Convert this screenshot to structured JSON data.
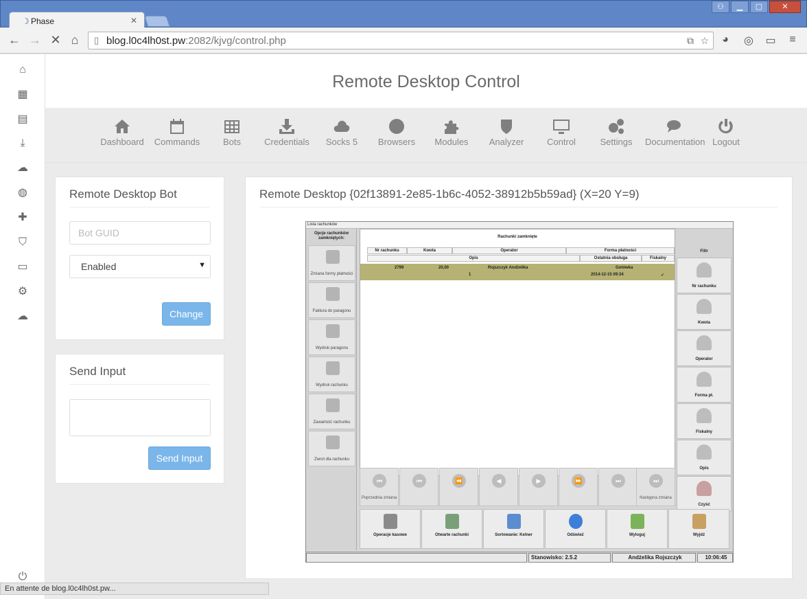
{
  "browser": {
    "tab_title": "Phase",
    "url_host": "blog.l0c4lh0st.pw",
    "url_rest": ":2082/kjvg/control.php",
    "status_text": "En attente de blog.l0c4lh0st.pw..."
  },
  "app": {
    "title": "Remote Desktop Control",
    "nav": [
      {
        "label": "Dashboard",
        "icon": "home-icon"
      },
      {
        "label": "Commands",
        "icon": "calendar-icon"
      },
      {
        "label": "Bots",
        "icon": "table-icon"
      },
      {
        "label": "Credentials",
        "icon": "download-icon"
      },
      {
        "label": "Socks 5",
        "icon": "cloud-icon"
      },
      {
        "label": "Browsers",
        "icon": "globe-icon"
      },
      {
        "label": "Modules",
        "icon": "puzzle-icon"
      },
      {
        "label": "Analyzer",
        "icon": "shield-icon"
      },
      {
        "label": "Control",
        "icon": "monitor-icon"
      },
      {
        "label": "Settings",
        "icon": "gears-icon"
      },
      {
        "label": "Documentation",
        "icon": "comments-icon"
      },
      {
        "label": "Logout",
        "icon": "power-icon"
      }
    ],
    "sidebar_icons": [
      "home-icon",
      "calendar-icon",
      "table-icon",
      "download-icon",
      "cloud-icon",
      "globe-icon",
      "puzzle-icon",
      "shield-icon",
      "monitor-icon",
      "gears-icon",
      "comments-icon",
      "power-icon"
    ]
  },
  "bot_panel": {
    "title": "Remote Desktop Bot",
    "guid_placeholder": "Bot GUID",
    "status_value": "Enabled",
    "button": "Change"
  },
  "input_panel": {
    "title": "Send Input",
    "button": "Send Input"
  },
  "desktop": {
    "title": "Remote Desktop {02f13891-2e85-1b6c-4052-38912b5b59ad} (X=20 Y=9)",
    "window_title": "Lista rachunków",
    "left_header": "Opcje rachunków zamkniętych:",
    "left_buttons": [
      "Zmiana formy płatności",
      "Faktura do paragonu",
      "Wydruk paragonu",
      "Wydruk rachunku",
      "Zawartość rachunku",
      "Zwrot dla rachunku"
    ],
    "main_header": "Rachunki zamknięte",
    "columns_row1": [
      "Nr rachunku",
      "Kwota",
      "Operator",
      "Forma płatności"
    ],
    "columns_row2": [
      "Opis",
      "Ostatnia obsługa",
      "Fiskalny"
    ],
    "row": {
      "nr": "2799",
      "kwota": "20,00",
      "operator": "Rojszczyk Andżelika",
      "forma": "Gotówka",
      "opis": "1",
      "ostatnia": "2014-12-15 09:34",
      "fiskalny": "✓"
    },
    "filter_header": "Filtr",
    "filter_buttons": [
      "Nr rachunku",
      "Kwota",
      "Operator",
      "Forma pł.",
      "Fiskalny",
      "Opis",
      "Czyść"
    ],
    "nav_buttons": [
      "Poprzednia zmiana",
      "",
      "",
      "",
      "",
      "",
      "",
      "Następna zmiana"
    ],
    "bottom_buttons": [
      "Operacje kasowe",
      "Otwarte rachunki",
      "Sortowanie: Kelner",
      "Odśwież",
      "Wyloguj",
      "Wyjdź"
    ],
    "status_station": "Stanowisko: 2.5.2",
    "status_user": "Andżelika Rojszczyk",
    "status_time": "10:06:45"
  }
}
